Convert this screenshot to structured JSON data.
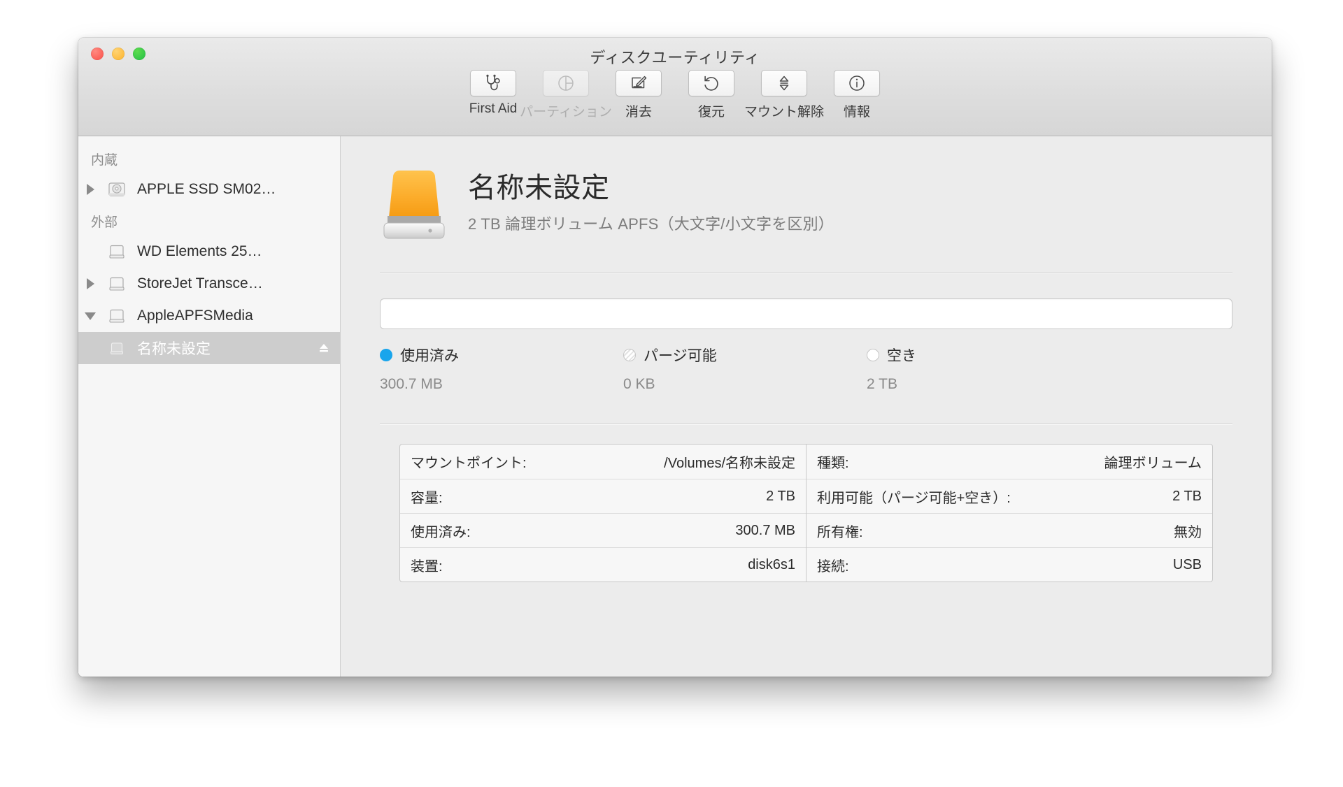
{
  "window": {
    "title": "ディスクユーティリティ",
    "traffic_lights": [
      "close",
      "minimize",
      "zoom"
    ]
  },
  "toolbar": {
    "items": [
      {
        "label": "First Aid",
        "icon": "stethoscope-icon",
        "disabled": false
      },
      {
        "label": "パーティション",
        "icon": "partition-pie-icon",
        "disabled": true
      },
      {
        "label": "消去",
        "icon": "erase-icon",
        "disabled": false
      },
      {
        "label": "復元",
        "icon": "restore-icon",
        "disabled": false
      },
      {
        "label": "マウント解除",
        "icon": "eject-icon",
        "disabled": false
      },
      {
        "label": "情報",
        "icon": "info-icon",
        "disabled": false
      }
    ]
  },
  "sidebar": {
    "groups": [
      {
        "title": "内蔵",
        "rows": [
          {
            "label": "APPLE SSD SM02…",
            "icon": "internal-disk-icon",
            "twisty": "right",
            "indent": false,
            "selected": false,
            "eject": false
          }
        ]
      },
      {
        "title": "外部",
        "rows": [
          {
            "label": "WD Elements 25…",
            "icon": "external-disk-icon",
            "twisty": "none",
            "indent": false,
            "selected": false,
            "eject": false
          },
          {
            "label": "StoreJet Transce…",
            "icon": "external-disk-icon",
            "twisty": "right",
            "indent": false,
            "selected": false,
            "eject": false
          },
          {
            "label": "AppleAPFSMedia",
            "icon": "external-disk-icon",
            "twisty": "down",
            "indent": false,
            "selected": false,
            "eject": false
          },
          {
            "label": "名称未設定",
            "icon": "volume-icon",
            "twisty": "none",
            "indent": true,
            "selected": true,
            "eject": true
          }
        ]
      }
    ]
  },
  "main": {
    "volume_name": "名称未設定",
    "volume_subtitle": "2 TB 論理ボリューム APFS（大文字/小文字を区別）",
    "capacity_bar": {
      "used_percent": 0.015,
      "used_color": "#19a5ec"
    },
    "legend": [
      {
        "name": "使用済み",
        "value": "300.7 MB",
        "swatch": "used"
      },
      {
        "name": "パージ可能",
        "value": "0 KB",
        "swatch": "purge"
      },
      {
        "name": "空き",
        "value": "2 TB",
        "swatch": "free"
      }
    ],
    "info_left": [
      {
        "key": "マウントポイント:",
        "value": "/Volumes/名称未設定"
      },
      {
        "key": "容量:",
        "value": "2 TB"
      },
      {
        "key": "使用済み:",
        "value": "300.7 MB"
      },
      {
        "key": "装置:",
        "value": "disk6s1"
      }
    ],
    "info_right": [
      {
        "key": "種類:",
        "value": "論理ボリューム"
      },
      {
        "key": "利用可能（パージ可能+空き）:",
        "value": "2 TB"
      },
      {
        "key": "所有権:",
        "value": "無効"
      },
      {
        "key": "接続:",
        "value": "USB"
      }
    ]
  }
}
